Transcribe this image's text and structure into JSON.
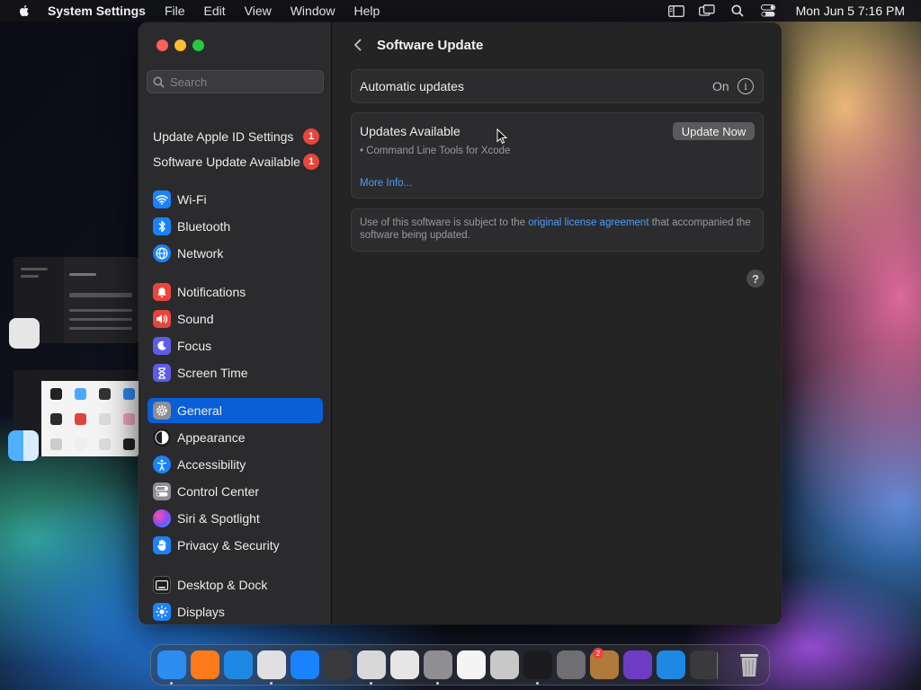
{
  "menubar": {
    "app_name": "System Settings",
    "menus": [
      "File",
      "Edit",
      "View",
      "Window",
      "Help"
    ],
    "clock": "Mon Jun 5  7:16 PM"
  },
  "search": {
    "placeholder": "Search"
  },
  "sidebar": {
    "alerts": [
      {
        "label": "Update Apple ID Settings",
        "badge": "1"
      },
      {
        "label": "Software Update Available",
        "badge": "1"
      }
    ],
    "groups": [
      [
        {
          "label": "Wi-Fi",
          "icon": "wifi-icon",
          "color": "#1a82fb"
        },
        {
          "label": "Bluetooth",
          "icon": "bluetooth-icon",
          "color": "#1a82fb"
        },
        {
          "label": "Network",
          "icon": "network-icon",
          "color": "#1a82fb"
        }
      ],
      [
        {
          "label": "Notifications",
          "icon": "notifications-icon",
          "color": "#e8453c"
        },
        {
          "label": "Sound",
          "icon": "sound-icon",
          "color": "#e8453c"
        },
        {
          "label": "Focus",
          "icon": "focus-icon",
          "color": "#5e5ce6"
        },
        {
          "label": "Screen Time",
          "icon": "screen-time-icon",
          "color": "#5e5ce6"
        }
      ],
      [
        {
          "label": "General",
          "icon": "gear-icon",
          "color": "#8e8e93",
          "selected": true
        },
        {
          "label": "Appearance",
          "icon": "appearance-icon",
          "color": "#1c1c1e"
        },
        {
          "label": "Accessibility",
          "icon": "accessibility-icon",
          "color": "#1a82fb"
        },
        {
          "label": "Control Center",
          "icon": "control-center-icon",
          "color": "#8e8e93"
        },
        {
          "label": "Siri & Spotlight",
          "icon": "siri-icon",
          "color": "#b04fd8"
        },
        {
          "label": "Privacy & Security",
          "icon": "hand-icon",
          "color": "#1a82fb"
        }
      ],
      [
        {
          "label": "Desktop & Dock",
          "icon": "dock-icon",
          "color": "#1c1c1e"
        },
        {
          "label": "Displays",
          "icon": "displays-icon",
          "color": "#1a82fb"
        }
      ]
    ]
  },
  "main": {
    "title": "Software Update",
    "automatic": {
      "label": "Automatic updates",
      "value": "On"
    },
    "updates": {
      "label": "Updates Available",
      "button": "Update Now",
      "item": "• Command Line Tools for Xcode",
      "more": "More Info..."
    },
    "license": {
      "before": "Use of this software is subject to the ",
      "link": "original license agreement",
      "after": " that accompanied the software being updated."
    },
    "help": "?"
  },
  "dock": {
    "apps": [
      {
        "name": "finder-icon",
        "color": "#2d8cf0"
      },
      {
        "name": "firefox-icon",
        "color": "#ff7a1a"
      },
      {
        "name": "safari-icon",
        "color": "#1e88e5"
      },
      {
        "name": "chrome-icon",
        "color": "#e0e0e0"
      },
      {
        "name": "app-store-icon",
        "color": "#1a82fb"
      },
      {
        "name": "screenshot-icon",
        "color": "#3a3a3c"
      },
      {
        "name": "preview-icon",
        "color": "#d8d8d8"
      },
      {
        "name": "script-editor-icon",
        "color": "#e6e6e6"
      },
      {
        "name": "system-settings-icon",
        "color": "#8e8e93"
      },
      {
        "name": "textedit-icon",
        "color": "#f4f4f4"
      },
      {
        "name": "migration-assistant-icon",
        "color": "#c8c8c8"
      },
      {
        "name": "terminal-icon",
        "color": "#1c1c1e"
      },
      {
        "name": "utility-icon",
        "color": "#6e6e73"
      },
      {
        "name": "instruments-icon",
        "color": "#b07a3a"
      },
      {
        "name": "visual-studio-icon",
        "color": "#6e3cc4"
      },
      {
        "name": "vscode-icon",
        "color": "#1e88e5"
      },
      {
        "name": "launchpad-icon",
        "color": "#3a3a3c"
      }
    ],
    "trash": "trash-icon",
    "settings_badge": "2"
  }
}
